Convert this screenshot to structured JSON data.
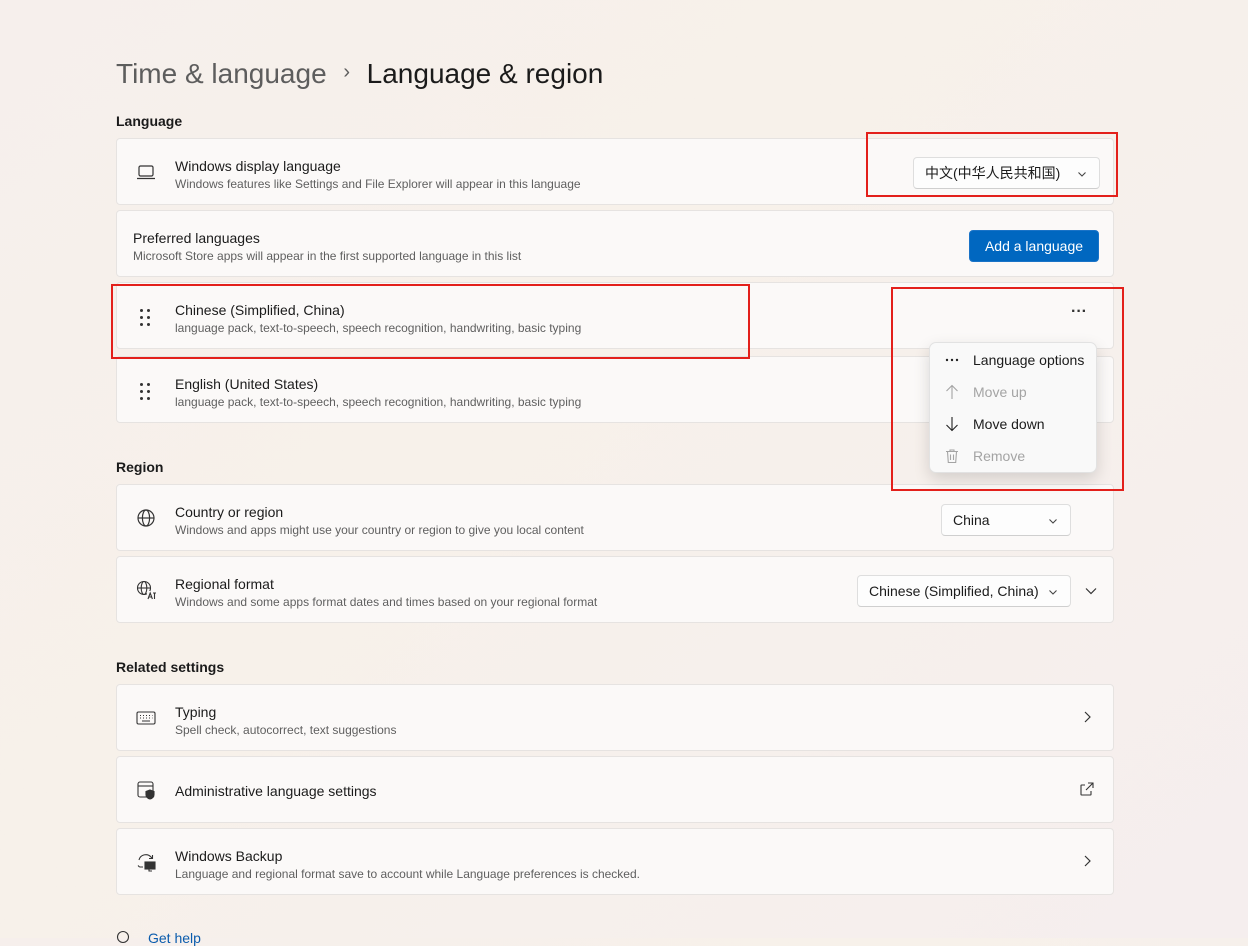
{
  "breadcrumb": {
    "parent": "Time & language",
    "separator": "›",
    "current": "Language & region"
  },
  "language_section": {
    "heading": "Language",
    "display_language": {
      "title": "Windows display language",
      "subtitle": "Windows features like Settings and File Explorer will appear in this language",
      "value": "中文(中华人民共和国)",
      "icon": "laptop-icon"
    },
    "preferred": {
      "title": "Preferred languages",
      "subtitle": "Microsoft Store apps will appear in the first supported language in this list",
      "button": "Add a language"
    },
    "languages": [
      {
        "title": "Chinese (Simplified, China)",
        "subtitle": "language pack, text-to-speech, speech recognition, handwriting, basic typing"
      },
      {
        "title": "English (United States)",
        "subtitle": "language pack, text-to-speech, speech recognition, handwriting, basic typing"
      }
    ],
    "more_button": "···"
  },
  "context_menu": {
    "items": [
      {
        "label": "Language options",
        "icon": "more-icon",
        "enabled": true
      },
      {
        "label": "Move up",
        "icon": "arrow-up-icon",
        "enabled": false
      },
      {
        "label": "Move down",
        "icon": "arrow-down-icon",
        "enabled": true
      },
      {
        "label": "Remove",
        "icon": "trash-icon",
        "enabled": false
      }
    ]
  },
  "region_section": {
    "heading": "Region",
    "country": {
      "title": "Country or region",
      "subtitle": "Windows and apps might use your country or region to give you local content",
      "value": "China",
      "icon": "globe-icon"
    },
    "format": {
      "title": "Regional format",
      "subtitle": "Windows and some apps format dates and times based on your regional format",
      "value": "Chinese (Simplified, China)",
      "icon": "regional-format-icon"
    }
  },
  "related_section": {
    "heading": "Related settings",
    "typing": {
      "title": "Typing",
      "subtitle": "Spell check, autocorrect, text suggestions",
      "icon": "keyboard-icon"
    },
    "admin": {
      "title": "Administrative language settings",
      "icon": "admin-shield-icon"
    },
    "backup": {
      "title": "Windows Backup",
      "subtitle": "Language and regional format save to account while Language preferences is checked.",
      "icon": "backup-icon"
    }
  },
  "footer": {
    "get_help": "Get help"
  },
  "colors": {
    "accent": "#0067c0",
    "highlight": "#e3201b"
  }
}
